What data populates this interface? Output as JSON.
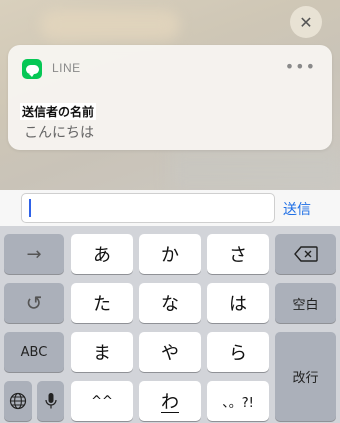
{
  "notification": {
    "close_symbol": "✕",
    "app_name": "LINE",
    "app_icon": "line-app-icon",
    "more_symbol": "•••",
    "sender": "送信者の名前",
    "message": "こんにちは",
    "colors": {
      "line_green": "#06c755"
    }
  },
  "reply": {
    "value": "",
    "placeholder": "",
    "send_label": "送信",
    "accent": "#1f6fe5"
  },
  "keyboard": {
    "row1": {
      "arrow": "→",
      "k1": "あ",
      "k2": "か",
      "k3": "さ",
      "delete_icon": "delete-icon"
    },
    "row2": {
      "undo": "↺",
      "k1": "た",
      "k2": "な",
      "k3": "は",
      "space": "空白"
    },
    "row3": {
      "abc": "ABC",
      "k1": "ま",
      "k2": "や",
      "k3": "ら",
      "enter": "改行"
    },
    "row4": {
      "globe_icon": "globe-icon",
      "mic_icon": "mic-icon",
      "k1": "^^",
      "k2": "わ",
      "k3": "、。?!"
    }
  }
}
